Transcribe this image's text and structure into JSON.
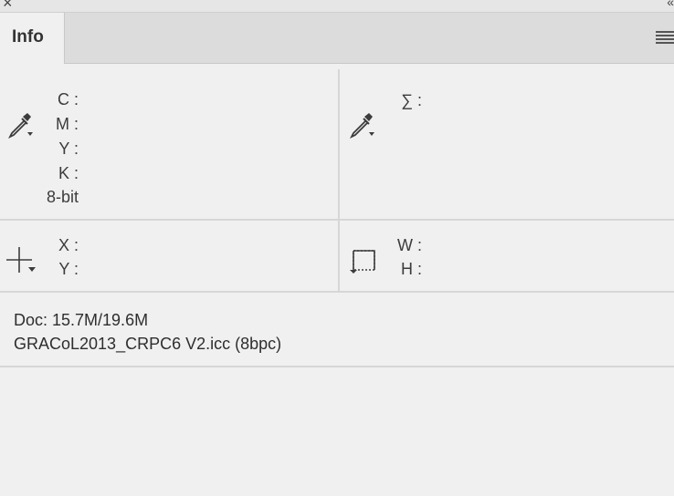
{
  "window": {
    "close_glyph": "×",
    "collapse_glyph": "«"
  },
  "tab": {
    "label": "Info"
  },
  "color_readout": {
    "labels": [
      "C :",
      "M :",
      "Y :",
      "K :"
    ],
    "bit_depth": "8-bit"
  },
  "sum_readout": {
    "label": "∑ :"
  },
  "position_readout": {
    "x_label": "X :",
    "y_label": "Y :"
  },
  "size_readout": {
    "w_label": "W :",
    "h_label": "H :"
  },
  "document": {
    "size": "Doc: 15.7M/19.6M",
    "profile": "GRACoL2013_CRPC6 V2.icc (8bpc)"
  },
  "icons": {
    "sampler_1": "eyedropper-icon",
    "sampler_2": "eyedropper-icon",
    "position": "crosshair-icon",
    "size": "selection-rect-icon",
    "menu": "panel-menu-icon"
  },
  "colors": {
    "panel_bg": "#f0f0f0",
    "tabbar_bg": "#dcdcdc",
    "divider": "#d6d6d6",
    "text": "#3a3a3a"
  }
}
